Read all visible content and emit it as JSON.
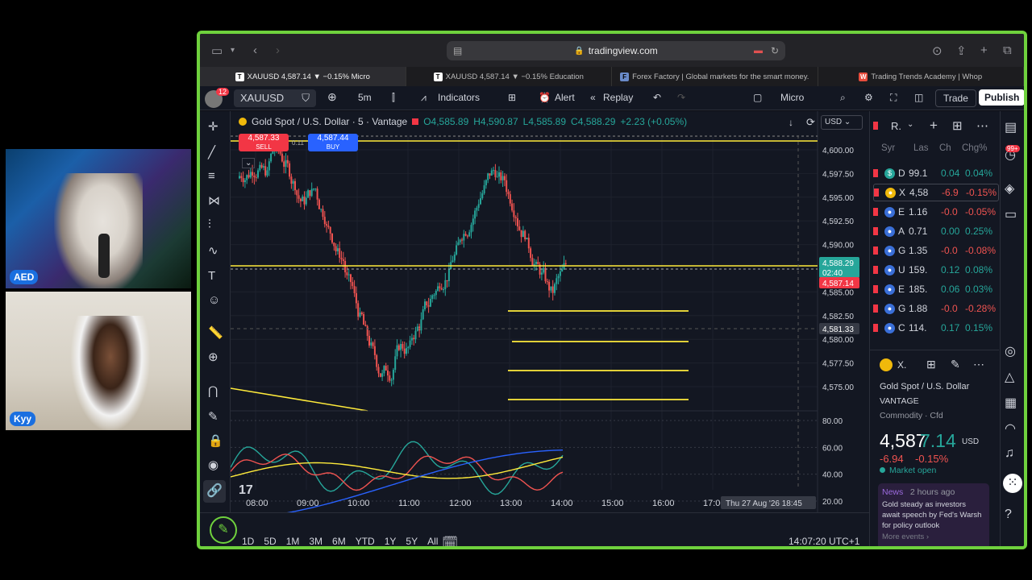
{
  "webcams": [
    {
      "label": "AED"
    },
    {
      "label": "Kyy"
    }
  ],
  "browser": {
    "url": "tradingview.com",
    "tabs": [
      {
        "title": "XAUUSD 4,587.14 ▼ −0.15% Micro",
        "icon": "T"
      },
      {
        "title": "XAUUSD 4,587.14 ▼ −0.15% Education",
        "icon": "T"
      },
      {
        "title": "Forex Factory | Global markets for the smart money.",
        "icon": "F"
      },
      {
        "title": "Trading Trends Academy | Whop",
        "icon": "W"
      }
    ]
  },
  "toolbar": {
    "badge": "12",
    "symbol": "XAUUSD",
    "interval": "5m",
    "indicators": "Indicators",
    "alert": "Alert",
    "replay": "Replay",
    "layout": "Micro",
    "trade": "Trade",
    "publish": "Publish"
  },
  "legend": {
    "name": "Gold Spot / U.S. Dollar · 5 · Vantage",
    "o": "O4,585.89",
    "h": "H4,590.87",
    "l": "L4,585.89",
    "c": "C4,588.29",
    "chg": "+2.23 (+0.05%)"
  },
  "trade_buttons": {
    "sell_price": "4,587.33",
    "sell": "SELL",
    "spread": "0.11",
    "buy_price": "4,587.44",
    "buy": "BUY"
  },
  "currency": "USD",
  "price_axis": [
    "4,600.00",
    "4,597.50",
    "4,595.00",
    "4,592.50",
    "4,590.00",
    "4,585.00",
    "4,582.50",
    "4,580.00",
    "4,577.50",
    "4,575.00"
  ],
  "price_labels": {
    "last": "4,588.29",
    "countdown": "02:40",
    "bid": "4,587.14",
    "crosshair": "4,581.33"
  },
  "osc_axis": [
    "80.00",
    "60.00",
    "40.00",
    "20.00"
  ],
  "time_axis": [
    "08:00",
    "09:00",
    "10:00",
    "11:00",
    "12:00",
    "13:00",
    "14:00",
    "15:00",
    "16:00",
    "17:00"
  ],
  "crosshair_time": "Thu 27 Aug '26   18:45",
  "ranges": [
    "1D",
    "5D",
    "1M",
    "3M",
    "6M",
    "YTD",
    "1Y",
    "5Y",
    "All"
  ],
  "clock": "14:07:20 UTC+1",
  "watchlist": {
    "title": "R.",
    "headers": [
      "Syr",
      "Las",
      "Ch",
      "Chg%"
    ],
    "rows": [
      {
        "sym": "D",
        "last": "99.1",
        "chg": "0.04",
        "pct": "0.04%",
        "dir": "up",
        "icon": "$",
        "ic": "#26a69a"
      },
      {
        "sym": "X",
        "last": "4,58",
        "chg": "-6.9",
        "pct": "-0.15%",
        "dir": "down",
        "icon": "●",
        "ic": "#f0b90b"
      },
      {
        "sym": "E",
        "last": "1.16",
        "chg": "-0.0",
        "pct": "-0.05%",
        "dir": "down",
        "icon": "●",
        "ic": "#3a6fd8"
      },
      {
        "sym": "A",
        "last": "0.71",
        "chg": "0.00",
        "pct": "0.25%",
        "dir": "up",
        "icon": "●",
        "ic": "#3a6fd8"
      },
      {
        "sym": "G",
        "last": "1.35",
        "chg": "-0.0",
        "pct": "-0.08%",
        "dir": "down",
        "icon": "●",
        "ic": "#3a6fd8"
      },
      {
        "sym": "U",
        "last": "159.",
        "chg": "0.12",
        "pct": "0.08%",
        "dir": "up",
        "icon": "●",
        "ic": "#3a6fd8"
      },
      {
        "sym": "E",
        "last": "185.",
        "chg": "0.06",
        "pct": "0.03%",
        "dir": "up",
        "icon": "●",
        "ic": "#3a6fd8"
      },
      {
        "sym": "G",
        "last": "1.88",
        "chg": "-0.0",
        "pct": "-0.28%",
        "dir": "down",
        "icon": "●",
        "ic": "#3a6fd8"
      },
      {
        "sym": "C",
        "last": "114.",
        "chg": "0.17",
        "pct": "0.15%",
        "dir": "up",
        "icon": "●",
        "ic": "#3a6fd8"
      }
    ]
  },
  "details": {
    "sym": "X.",
    "name": "Gold Spot / U.S. Dollar",
    "exchange": "VANTAGE",
    "category": "Commodity · Cfd",
    "price_big": "4,587",
    "price_small": "7.14",
    "currency": "USD",
    "change": "-6.94",
    "change_pct": "-0.15%",
    "status": "Market open",
    "news_tag": "News",
    "news_time": "2 hours ago",
    "news_text": "Gold steady as investors await speech by Fed's Warsh for policy outlook",
    "more_events": "More events ›"
  },
  "notif_badge": "99+",
  "colors": {
    "up": "#26a69a",
    "down": "#ef5350",
    "accent": "#2962ff",
    "frame": "#6fd13d",
    "level": "#ffeb3b"
  }
}
